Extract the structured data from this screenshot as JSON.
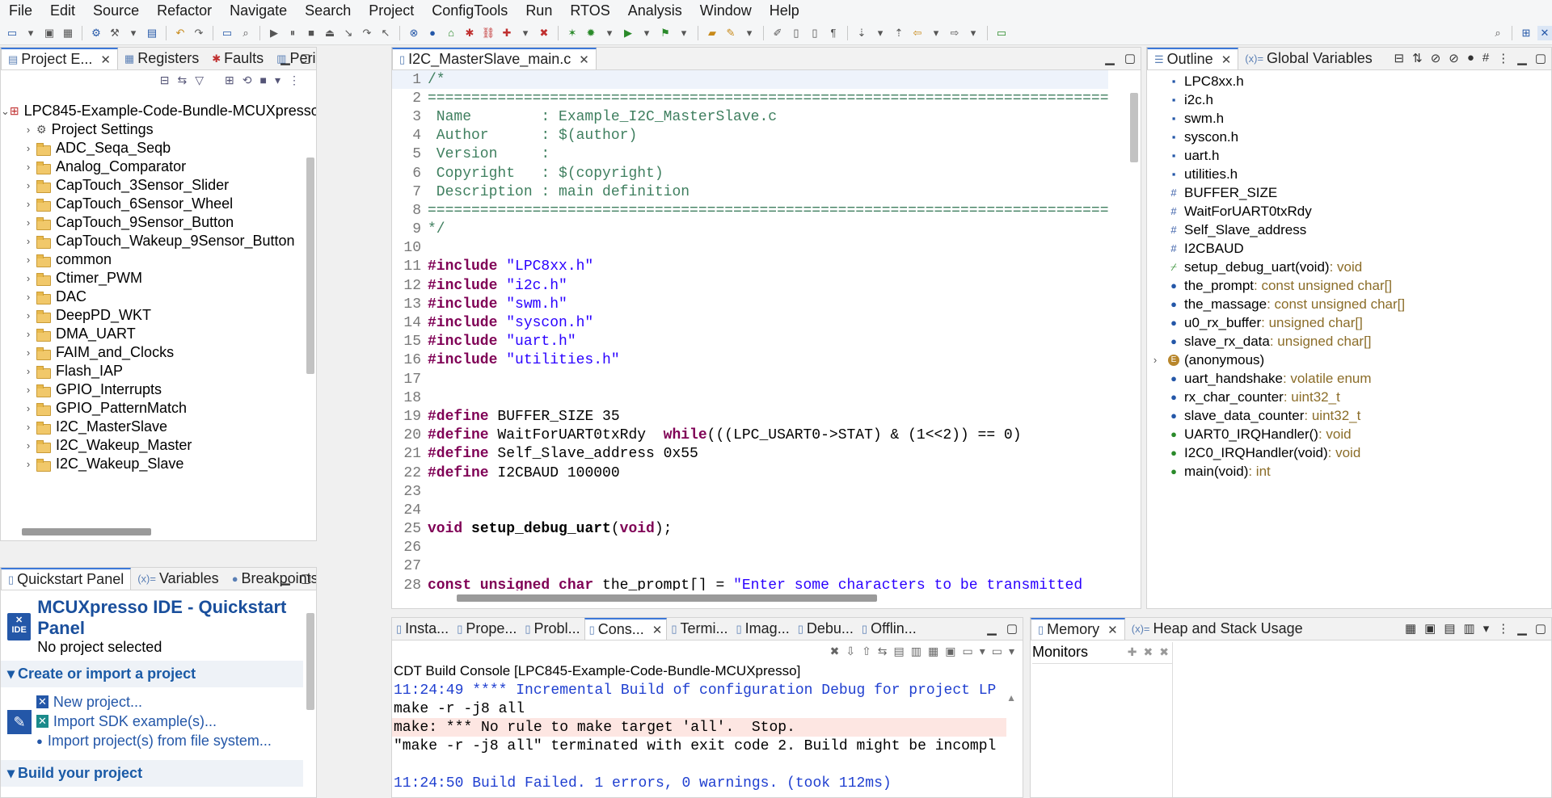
{
  "menu": [
    "File",
    "Edit",
    "Source",
    "Refactor",
    "Navigate",
    "Search",
    "Project",
    "ConfigTools",
    "Run",
    "RTOS",
    "Analysis",
    "Window",
    "Help"
  ],
  "project_explorer": {
    "tabs": [
      "Project E...",
      "Registers",
      "Faults",
      "Peripher..."
    ],
    "root": "LPC845-Example-Code-Bundle-MCUXpresso",
    "items": [
      "Project Settings",
      "ADC_Seqa_Seqb",
      "Analog_Comparator",
      "CapTouch_3Sensor_Slider",
      "CapTouch_6Sensor_Wheel",
      "CapTouch_9Sensor_Button",
      "CapTouch_Wakeup_9Sensor_Button",
      "common",
      "Ctimer_PWM",
      "DAC",
      "DeepPD_WKT",
      "DMA_UART",
      "FAIM_and_Clocks",
      "Flash_IAP",
      "GPIO_Interrupts",
      "GPIO_PatternMatch",
      "I2C_MasterSlave",
      "I2C_Wakeup_Master",
      "I2C_Wakeup_Slave"
    ]
  },
  "quickstart": {
    "tabs": [
      "Quickstart Panel",
      "Variables",
      "Breakpoints"
    ],
    "title": "MCUXpresso IDE - Quickstart Panel",
    "subtitle": "No project selected",
    "ide_label": "IDE",
    "section1": "Create or import a project",
    "links": [
      "New project...",
      "Import SDK example(s)...",
      "Import project(s) from file system..."
    ],
    "section2": "Build your project"
  },
  "editor": {
    "tab": "I2C_MasterSlave_main.c",
    "lines": [
      {
        "n": "1",
        "t": "/*",
        "c": "cm"
      },
      {
        "n": "2",
        "t": "================================================================================",
        "c": "cm"
      },
      {
        "n": "3",
        "t": " Name        : Example_I2C_MasterSlave.c",
        "c": "cm"
      },
      {
        "n": "4",
        "t": " Author      : $(author)",
        "c": "cm"
      },
      {
        "n": "5",
        "t": " Version     :",
        "c": "cm"
      },
      {
        "n": "6",
        "t": " Copyright   : $(copyright)",
        "c": "cm"
      },
      {
        "n": "7",
        "t": " Description : main definition",
        "c": "cm"
      },
      {
        "n": "8",
        "t": "================================================================================",
        "c": "cm"
      },
      {
        "n": "9",
        "t": "*/",
        "c": "cm"
      },
      {
        "n": "10",
        "t": "",
        "c": ""
      },
      {
        "n": "11",
        "k": "#include ",
        "s": "\"LPC8xx.h\""
      },
      {
        "n": "12",
        "k": "#include ",
        "s": "\"i2c.h\""
      },
      {
        "n": "13",
        "k": "#include ",
        "s": "\"swm.h\""
      },
      {
        "n": "14",
        "k": "#include ",
        "s": "\"syscon.h\""
      },
      {
        "n": "15",
        "k": "#include ",
        "s": "\"uart.h\""
      },
      {
        "n": "16",
        "k": "#include ",
        "s": "\"utilities.h\""
      },
      {
        "n": "17",
        "t": "",
        "c": ""
      },
      {
        "n": "18",
        "t": "",
        "c": ""
      },
      {
        "n": "19",
        "k": "#define ",
        "r": "BUFFER_SIZE 35"
      },
      {
        "n": "20",
        "k": "#define ",
        "r": "WaitForUART0txRdy  ",
        "k2": "while",
        "r2": "(((LPC_USART0->STAT) & (1<<2)) == 0)"
      },
      {
        "n": "21",
        "k": "#define ",
        "r": "Self_Slave_address 0x55"
      },
      {
        "n": "22",
        "k": "#define ",
        "r": "I2CBAUD 100000"
      },
      {
        "n": "23",
        "t": "",
        "c": ""
      },
      {
        "n": "24",
        "t": "",
        "c": ""
      },
      {
        "n": "25",
        "k": "void ",
        "f": "setup_debug_uart",
        "r": "(",
        "k2": "void",
        "r2": ");"
      },
      {
        "n": "26",
        "t": "",
        "c": ""
      },
      {
        "n": "27",
        "t": "",
        "c": ""
      },
      {
        "n": "28",
        "k": "const unsigned char ",
        "r": "the_prompt[] = ",
        "s": "\"Enter some characters to be transmitted"
      }
    ]
  },
  "outline": {
    "tabs": [
      "Outline",
      "Global Variables"
    ],
    "items": [
      {
        "icon": "include",
        "name": "LPC8xx.h",
        "type": ""
      },
      {
        "icon": "include",
        "name": "i2c.h",
        "type": ""
      },
      {
        "icon": "include",
        "name": "swm.h",
        "type": ""
      },
      {
        "icon": "include",
        "name": "syscon.h",
        "type": ""
      },
      {
        "icon": "include",
        "name": "uart.h",
        "type": ""
      },
      {
        "icon": "include",
        "name": "utilities.h",
        "type": ""
      },
      {
        "icon": "macro",
        "name": "BUFFER_SIZE",
        "type": ""
      },
      {
        "icon": "macro",
        "name": "WaitForUART0txRdy",
        "type": ""
      },
      {
        "icon": "macro",
        "name": "Self_Slave_address",
        "type": ""
      },
      {
        "icon": "macro",
        "name": "I2CBAUD",
        "type": ""
      },
      {
        "icon": "decl",
        "name": "setup_debug_uart(void)",
        "type": " : void"
      },
      {
        "icon": "var",
        "name": "the_prompt",
        "type": " : const unsigned char[]"
      },
      {
        "icon": "var",
        "name": "the_massage",
        "type": " : const unsigned char[]"
      },
      {
        "icon": "var",
        "name": "u0_rx_buffer",
        "type": " : unsigned char[]"
      },
      {
        "icon": "var",
        "name": "slave_rx_data",
        "type": " : unsigned char[]"
      },
      {
        "icon": "enum",
        "name": "(anonymous)",
        "type": ""
      },
      {
        "icon": "var",
        "name": "uart_handshake",
        "type": " : volatile enum"
      },
      {
        "icon": "var",
        "name": "rx_char_counter",
        "type": " : uint32_t"
      },
      {
        "icon": "var",
        "name": "slave_data_counter",
        "type": " : uint32_t"
      },
      {
        "icon": "fn",
        "name": "UART0_IRQHandler()",
        "type": " : void"
      },
      {
        "icon": "fn",
        "name": "I2C0_IRQHandler(void)",
        "type": " : void"
      },
      {
        "icon": "fn",
        "name": "main(void)",
        "type": " : int"
      }
    ]
  },
  "console": {
    "tabs": [
      "Insta...",
      "Prope...",
      "Probl...",
      "Cons...",
      "Termi...",
      "Imag...",
      "Debu...",
      "Offlin..."
    ],
    "title": "CDT Build Console [LPC845-Example-Code-Bundle-MCUXpresso]",
    "lines": [
      {
        "t": "11:24:49 **** Incremental Build of configuration Debug for project LP",
        "c": "kblue"
      },
      {
        "t": "make -r -j8 all",
        "c": ""
      },
      {
        "t": "make: *** No rule to make target 'all'.  Stop.",
        "c": "kerr"
      },
      {
        "t": "\"make -r -j8 all\" terminated with exit code 2. Build might be incompl",
        "c": ""
      },
      {
        "t": "",
        "c": ""
      },
      {
        "t": "11:24:50 Build Failed. 1 errors, 0 warnings. (took 112ms)",
        "c": "kblue"
      }
    ]
  },
  "memory": {
    "tabs": [
      "Memory",
      "Heap and Stack Usage"
    ],
    "monitors": "Monitors"
  }
}
